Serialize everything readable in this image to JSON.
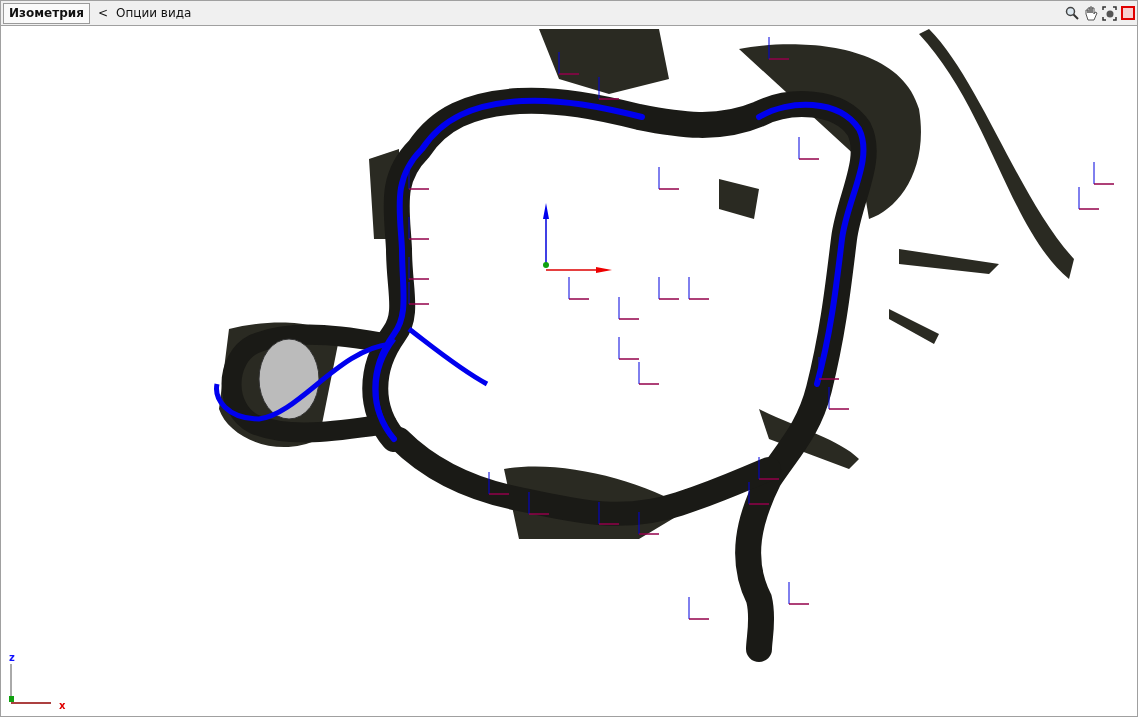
{
  "tabs": [
    {
      "label": "Изометрия",
      "selected": true
    }
  ],
  "view_options": {
    "arrow": "<",
    "label": "Опции вида"
  },
  "axes": {
    "z_label": "z",
    "x_label": "x"
  }
}
